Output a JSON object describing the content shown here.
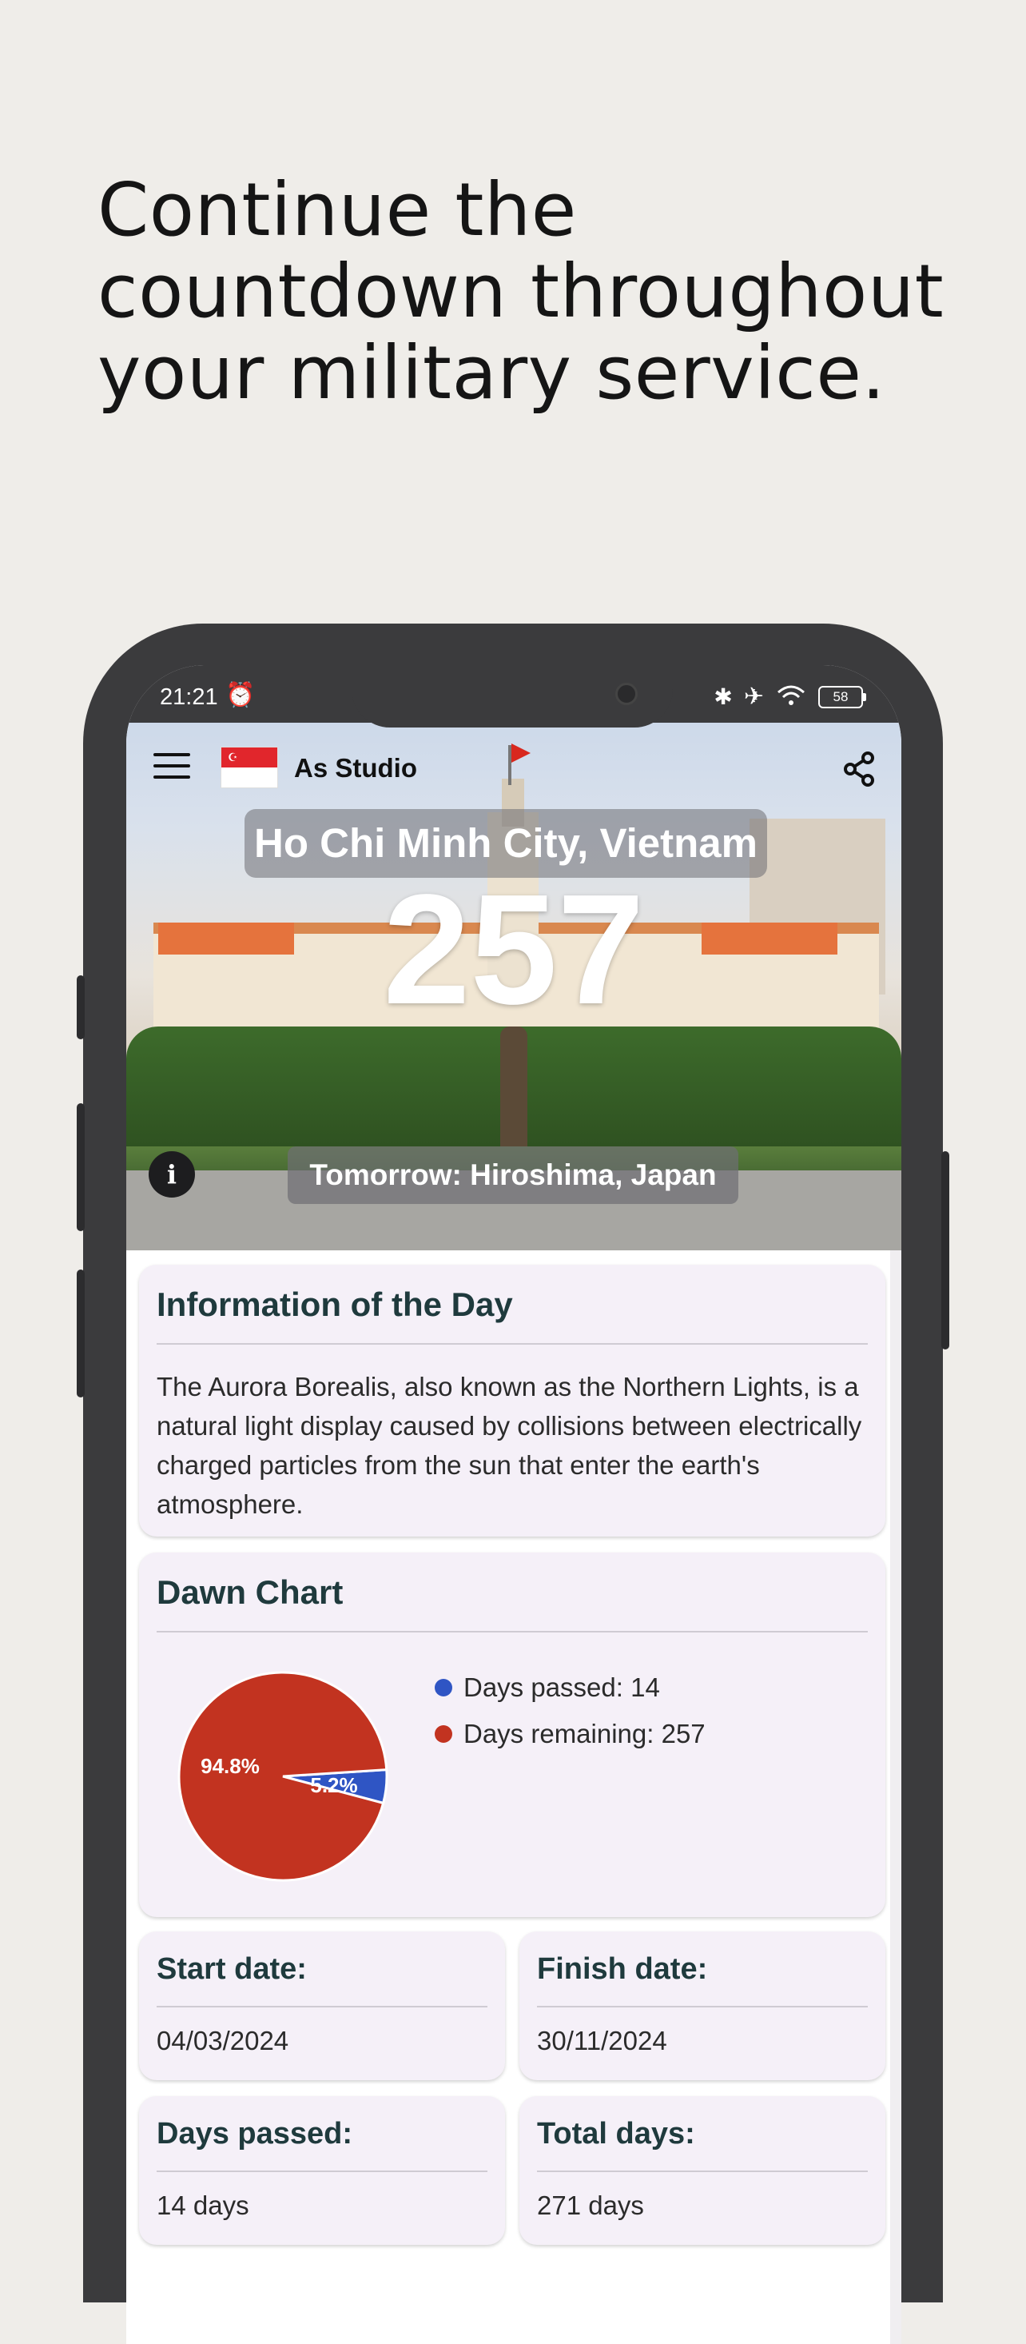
{
  "headline": {
    "line1": "Continue the",
    "line2": "countdown throughout",
    "line3": "your military service."
  },
  "status_bar": {
    "time": "21:21",
    "battery": "58"
  },
  "app_bar": {
    "title": "As Studio"
  },
  "hero": {
    "city": "Ho Chi Minh City, Vietnam",
    "countdown": "257",
    "tomorrow": "Tomorrow: Hiroshima, Japan",
    "info_icon_glyph": "i"
  },
  "info_card": {
    "title": "Information of the Day",
    "text": "The Aurora Borealis, also known as the Northern Lights, is a natural light display caused by collisions between electrically charged particles from the sun that enter the earth's atmosphere."
  },
  "chart_card": {
    "title": "Dawn Chart"
  },
  "chart_data": {
    "type": "pie",
    "slices": [
      {
        "label": "Days passed: 14",
        "value": 14,
        "percent_label": "5.2%",
        "color": "#2f55c4"
      },
      {
        "label": "Days remaining: 257",
        "value": 257,
        "percent_label": "94.8%",
        "color": "#c23320"
      }
    ]
  },
  "stats": {
    "start_title": "Start date:",
    "start_value": "04/03/2024",
    "finish_title": "Finish date:",
    "finish_value": "30/11/2024",
    "passed_title": "Days passed:",
    "passed_value": "14 days",
    "total_title": "Total days:",
    "total_value": "271 days"
  },
  "colors": {
    "background": "#efede9",
    "card": "#f5f0f8",
    "card_title": "#1f3a3d",
    "pie_passed": "#2f55c4",
    "pie_remaining": "#c23320"
  }
}
